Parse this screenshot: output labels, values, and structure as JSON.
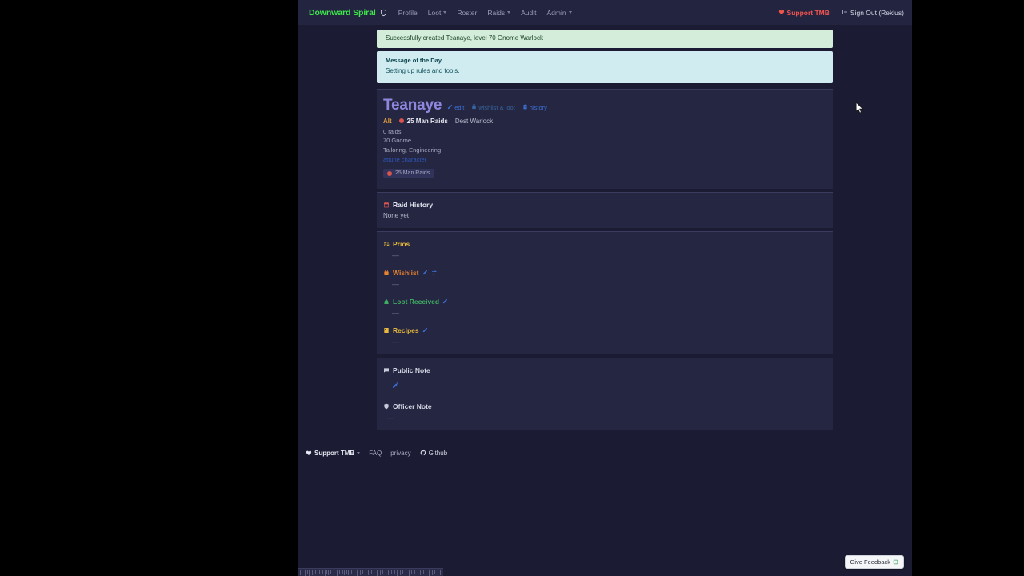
{
  "navbar": {
    "brand": "Downward Spiral",
    "brand_icon": "shield-icon",
    "links": [
      {
        "label": "Profile",
        "has_caret": false
      },
      {
        "label": "Loot",
        "has_caret": true
      },
      {
        "label": "Roster",
        "has_caret": false
      },
      {
        "label": "Raids",
        "has_caret": true
      },
      {
        "label": "Audit",
        "has_caret": false
      },
      {
        "label": "Admin",
        "has_caret": true
      }
    ],
    "support_label": "Support TMB",
    "support_icon": "heart-hands-icon",
    "signout_label": "Sign Out (Reklus)",
    "signout_icon": "sign-out-icon"
  },
  "alerts": {
    "success": "Successfully created Teanaye, level 70 Gnome Warlock",
    "motd_title": "Message of the Day",
    "motd_body": "Setting up rules and tools."
  },
  "character": {
    "name": "Teanaye",
    "links": [
      {
        "label": "edit",
        "icon": "pencil-icon"
      },
      {
        "label": "wishlist & loot",
        "icon": "backpack-icon"
      },
      {
        "label": "history",
        "icon": "clipboard-icon"
      }
    ],
    "tag_alt": "Alt",
    "raid_group": "25 Man Raids",
    "spec": "Dest Warlock",
    "raid_count": "0 raids",
    "level_race": "70 Gnome",
    "professions": "Tailoring, Engineering",
    "attune_link": "attune character",
    "raid_badge": "25 Man Raids"
  },
  "sections": {
    "raid_history": {
      "title": "Raid History",
      "icon": "calendar-icon",
      "body": "None yet"
    },
    "prios": {
      "title": "Prios",
      "icon": "sort-icon",
      "body": "—"
    },
    "wishlist": {
      "title": "Wishlist",
      "icon": "backpack-icon",
      "body": "—",
      "edit_icon": "pencil-icon",
      "swap_icon": "swap-icon"
    },
    "loot_received": {
      "title": "Loot Received",
      "icon": "bag-icon",
      "body": "—",
      "edit_icon": "pencil-icon"
    },
    "recipes": {
      "title": "Recipes",
      "icon": "book-icon",
      "body": "—",
      "edit_icon": "pencil-icon"
    },
    "public_note": {
      "title": "Public Note",
      "icon": "comment-icon",
      "edit_icon": "pencil-icon"
    },
    "officer_note": {
      "title": "Officer Note",
      "icon": "shield-icon",
      "body": "—"
    }
  },
  "footer": {
    "support_label": "Support TMB",
    "support_icon": "heart-hands-icon",
    "faq_label": "FAQ",
    "privacy_label": "privacy",
    "github_label": "Github",
    "github_icon": "github-icon"
  },
  "feedback": {
    "label": "Give Feedback",
    "icon": "external-link-icon"
  },
  "colors": {
    "brand_green": "#3ee84b",
    "page_bg": "#1b1c33",
    "nav_bg": "#232440",
    "card_bg": "#252641",
    "char_name": "#8e87de",
    "alt_tag": "#e8a33d",
    "support_red": "#f0544f",
    "link_blue": "#3c6fd4",
    "prios_gold": "#e8b93c",
    "wishlist_orange": "#e8822f",
    "loot_green": "#3fae63",
    "alert_success_bg": "#d4edda",
    "alert_info_bg": "#d1ecf1"
  }
}
